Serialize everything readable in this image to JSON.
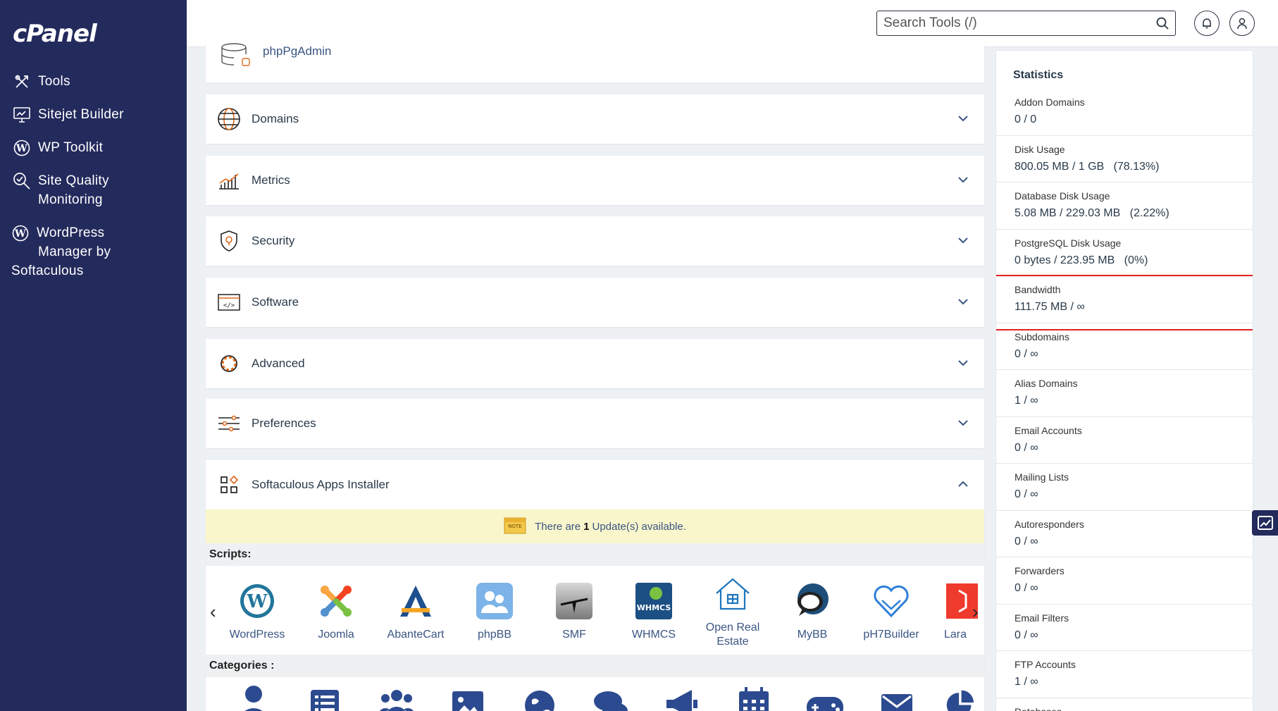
{
  "brand": {
    "logo": "cPanel"
  },
  "sidebar": {
    "items": [
      {
        "label": "Tools",
        "icon": "tools-icon"
      },
      {
        "label": "Sitejet Builder",
        "icon": "monitor-icon"
      },
      {
        "label": "WP Toolkit",
        "icon": "wordpress-icon"
      },
      {
        "label": "Site Quality Monitoring",
        "line1": "Site Quality",
        "line2": "Monitoring",
        "icon": "site-quality-icon"
      },
      {
        "label": "WordPress Manager by Softaculous",
        "line1": "WordPress",
        "line2": "Manager by",
        "line3": "Softaculous",
        "icon": "wordpress-icon"
      }
    ]
  },
  "header": {
    "search_placeholder": "Search Tools (/)",
    "notifications_icon": "bell-icon",
    "user_icon": "user-icon"
  },
  "main": {
    "top_item": {
      "label": "phpPgAdmin",
      "icon": "database-icon"
    },
    "groups": [
      {
        "title": "Domains",
        "icon": "globe-icon"
      },
      {
        "title": "Metrics",
        "icon": "bar-chart-icon"
      },
      {
        "title": "Security",
        "icon": "shield-icon"
      },
      {
        "title": "Software",
        "icon": "code-icon"
      },
      {
        "title": "Advanced",
        "icon": "gear-icon"
      },
      {
        "title": "Preferences",
        "icon": "sliders-icon"
      }
    ],
    "softaculous": {
      "title": "Softaculous Apps Installer",
      "notice_prefix": "There are",
      "notice_count": "1",
      "notice_suffix": "Update(s) available.",
      "notice_icon": "note-icon",
      "scripts_label": "Scripts:",
      "categories_label": "Categories :",
      "apps": [
        {
          "name": "WordPress"
        },
        {
          "name": "Joomla"
        },
        {
          "name": "AbanteCart"
        },
        {
          "name": "phpBB"
        },
        {
          "name": "SMF"
        },
        {
          "name": "WHMCS"
        },
        {
          "name": "Open Real Estate",
          "line1": "Open Real",
          "line2": "Estate"
        },
        {
          "name": "MyBB"
        },
        {
          "name": "pH7Builder"
        },
        {
          "name": "Lara"
        }
      ],
      "prev_arrow": "‹",
      "next_arrow": "›"
    }
  },
  "statistics": {
    "title": "Statistics",
    "items": [
      {
        "label": "Addon Domains",
        "value": "0 / 0"
      },
      {
        "label": "Disk Usage",
        "value": "800.05 MB / 1 GB   (78.13%)"
      },
      {
        "label": "Database Disk Usage",
        "value": "5.08 MB / 229.03 MB   (2.22%)"
      },
      {
        "label": "PostgreSQL Disk Usage",
        "value": "0 bytes / 223.95 MB   (0%)"
      },
      {
        "label": "Bandwidth",
        "value": "111.75 MB / ∞"
      },
      {
        "label": "Subdomains",
        "value": "0 / ∞"
      },
      {
        "label": "Alias Domains",
        "value": "1 / ∞"
      },
      {
        "label": "Email Accounts",
        "value": "0 / ∞"
      },
      {
        "label": "Mailing Lists",
        "value": "0 / ∞"
      },
      {
        "label": "Autoresponders",
        "value": "0 / ∞"
      },
      {
        "label": "Forwarders",
        "value": "0 / ∞"
      },
      {
        "label": "Email Filters",
        "value": "0 / ∞"
      },
      {
        "label": "FTP Accounts",
        "value": "1 / ∞"
      },
      {
        "label": "Databases",
        "value": ""
      }
    ]
  },
  "colors": {
    "sidebar": "#232a5c",
    "accent": "#3a5583",
    "highlight": "#e02020",
    "notice": "#f9f6cc"
  }
}
